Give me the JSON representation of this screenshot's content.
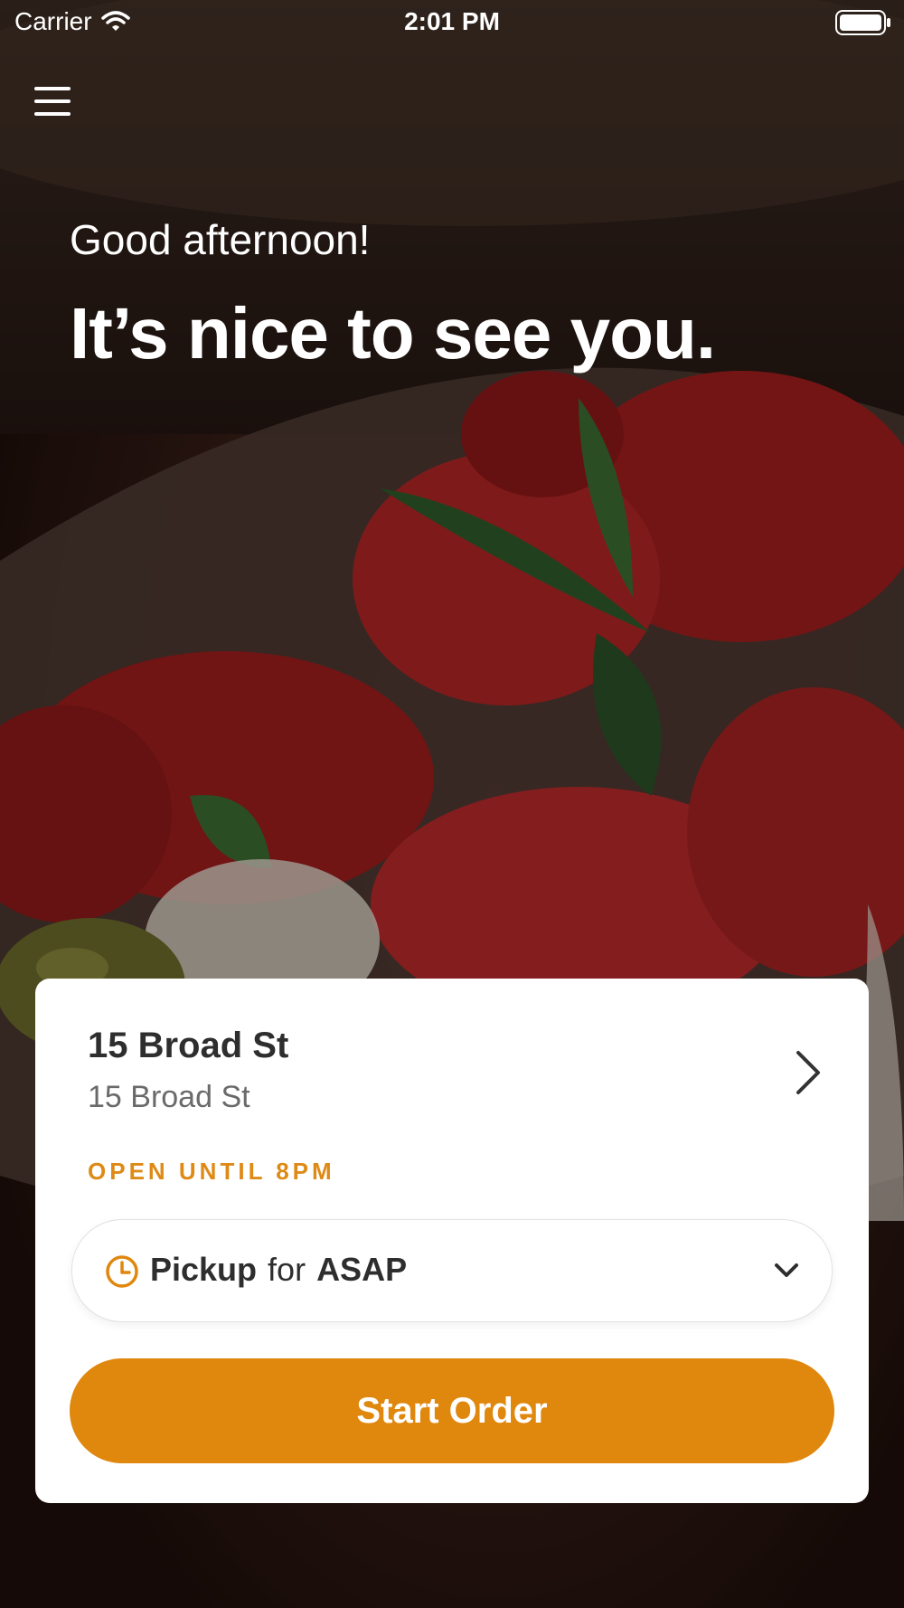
{
  "status_bar": {
    "carrier": "Carrier",
    "time": "2:01 PM",
    "icons": [
      "wifi-icon",
      "battery-icon"
    ]
  },
  "header": {
    "menu_icon": "hamburger-menu-icon",
    "greeting": "Good afternoon!",
    "headline": "It’s nice to see you."
  },
  "location_card": {
    "name": "15 Broad St",
    "address": "15 Broad St",
    "hours": "OPEN UNTIL 8PM",
    "chevron_icon": "chevron-right-icon"
  },
  "order_options": {
    "mode": "Pickup",
    "connector": "for",
    "time": "ASAP",
    "clock_icon": "clock-icon",
    "dropdown_icon": "chevron-down-icon"
  },
  "actions": {
    "start_order": "Start Order"
  },
  "colors": {
    "accent": "#e0870e",
    "hours_text": "#de8a16",
    "card_background": "#ffffff",
    "primary_text": "#2e2e2e",
    "secondary_text": "#6a6a6a"
  }
}
